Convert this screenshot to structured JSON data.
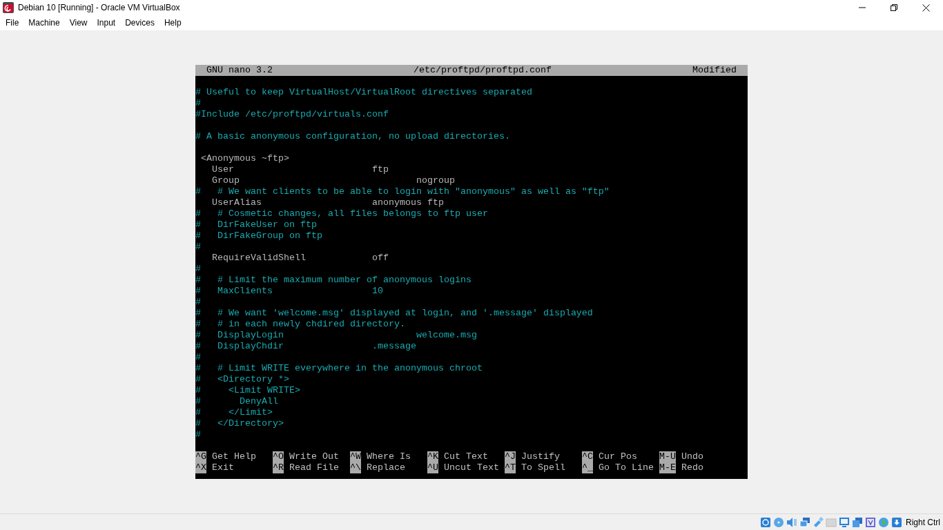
{
  "window": {
    "title": "Debian 10 [Running] - Oracle VM VirtualBox"
  },
  "menu": [
    "File",
    "Machine",
    "View",
    "Input",
    "Devices",
    "Help"
  ],
  "nano": {
    "version": "GNU nano 3.2",
    "filename": "/etc/proftpd/proftpd.conf",
    "status": "Modified",
    "lines": [
      {
        "kind": "blank"
      },
      {
        "kind": "comment",
        "text": "# Useful to keep VirtualHost/VirtualRoot directives separated"
      },
      {
        "kind": "comment",
        "text": "#"
      },
      {
        "kind": "comment",
        "text": "#Include /etc/proftpd/virtuals.conf"
      },
      {
        "kind": "blank"
      },
      {
        "kind": "comment",
        "text": "# A basic anonymous configuration, no upload directories."
      },
      {
        "kind": "blank"
      },
      {
        "kind": "directive",
        "text": " <Anonymous ~ftp>"
      },
      {
        "kind": "directive",
        "text": "   User                         ftp"
      },
      {
        "kind": "directive",
        "text": "   Group                                nogroup"
      },
      {
        "kind": "comment",
        "text": "#   # We want clients to be able to login with \"anonymous\" as well as \"ftp\""
      },
      {
        "kind": "directive",
        "text": "   UserAlias                    anonymous ftp"
      },
      {
        "kind": "comment",
        "text": "#   # Cosmetic changes, all files belongs to ftp user"
      },
      {
        "kind": "comment",
        "text": "#   DirFakeUser on ftp"
      },
      {
        "kind": "comment",
        "text": "#   DirFakeGroup on ftp"
      },
      {
        "kind": "comment",
        "text": "#"
      },
      {
        "kind": "directive",
        "text": "   RequireValidShell            off"
      },
      {
        "kind": "comment",
        "text": "#"
      },
      {
        "kind": "comment",
        "text": "#   # Limit the maximum number of anonymous logins"
      },
      {
        "kind": "comment",
        "text": "#   MaxClients                  10"
      },
      {
        "kind": "comment",
        "text": "#"
      },
      {
        "kind": "comment",
        "text": "#   # We want 'welcome.msg' displayed at login, and '.message' displayed"
      },
      {
        "kind": "comment",
        "text": "#   # in each newly chdired directory."
      },
      {
        "kind": "comment",
        "text": "#   DisplayLogin                        welcome.msg"
      },
      {
        "kind": "comment",
        "text": "#   DisplayChdir                .message"
      },
      {
        "kind": "comment",
        "text": "#"
      },
      {
        "kind": "comment",
        "text": "#   # Limit WRITE everywhere in the anonymous chroot"
      },
      {
        "kind": "comment",
        "text": "#   <Directory *>"
      },
      {
        "kind": "comment",
        "text": "#     <Limit WRITE>"
      },
      {
        "kind": "comment",
        "text": "#       DenyAll"
      },
      {
        "kind": "comment",
        "text": "#     </Limit>"
      },
      {
        "kind": "comment",
        "text": "#   </Directory>"
      },
      {
        "kind": "comment",
        "text": "#"
      }
    ],
    "shortcut_rows": [
      [
        {
          "key": "^G",
          "label": "Get Help"
        },
        {
          "key": "^O",
          "label": "Write Out"
        },
        {
          "key": "^W",
          "label": "Where Is"
        },
        {
          "key": "^K",
          "label": "Cut Text"
        },
        {
          "key": "^J",
          "label": "Justify"
        },
        {
          "key": "^C",
          "label": "Cur Pos"
        },
        {
          "key": "M-U",
          "label": "Undo"
        }
      ],
      [
        {
          "key": "^X",
          "label": "Exit"
        },
        {
          "key": "^R",
          "label": "Read File"
        },
        {
          "key": "^\\",
          "label": "Replace"
        },
        {
          "key": "^U",
          "label": "Uncut Text"
        },
        {
          "key": "^T",
          "label": "To Spell"
        },
        {
          "key": "^_",
          "label": "Go To Line"
        },
        {
          "key": "M-E",
          "label": "Redo"
        }
      ]
    ]
  },
  "status_bar": {
    "host_key": "Right Ctrl"
  }
}
